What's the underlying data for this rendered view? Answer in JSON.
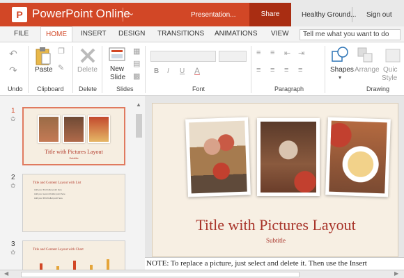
{
  "app": {
    "title": "PowerPoint Online",
    "logo_letter": "P"
  },
  "header": {
    "present_label": "Presentation...",
    "share_label": "Share",
    "user_name": "Healthy Ground...",
    "signout_label": "Sign out"
  },
  "tabs": [
    "FILE",
    "HOME",
    "INSERT",
    "DESIGN",
    "TRANSITIONS",
    "ANIMATIONS",
    "VIEW"
  ],
  "active_tab": "HOME",
  "tell_me": {
    "text": "Tell me what you want to do"
  },
  "ribbon": {
    "groups": [
      "Undo",
      "Clipboard",
      "Delete",
      "Slides",
      "Font",
      "Paragraph",
      "Drawing"
    ],
    "paste_label": "Paste",
    "delete_label": "Delete",
    "new_slide_label": [
      "New",
      "Slide"
    ],
    "shapes_label": "Shapes",
    "arrange_label": "Arrange",
    "quick_styles_label": [
      "Quic",
      "Style"
    ],
    "font_buttons": [
      "B",
      "I",
      "U",
      "A"
    ]
  },
  "thumbnails": [
    {
      "number": "1",
      "title": "Title with Pictures Layout",
      "subtitle": "Subtitle"
    },
    {
      "number": "2",
      "title": "Title and Content Layout with List",
      "bullets": [
        "Add your first bullet point here",
        "Add your second bullet point here",
        "Add your third bullet point here"
      ]
    },
    {
      "number": "3",
      "title": "Title and Content Layout with Chart"
    }
  ],
  "slide": {
    "title": "Title with Pictures Layout",
    "subtitle": "Subtitle"
  },
  "notes": {
    "text": "NOTE: To replace a picture, just select and delete it. Then use the Insert"
  },
  "colors": {
    "brand": "#d24726",
    "share_bg": "#a92d12",
    "slide_title": "#a8342a",
    "slide_bg": "#f7efe3"
  }
}
